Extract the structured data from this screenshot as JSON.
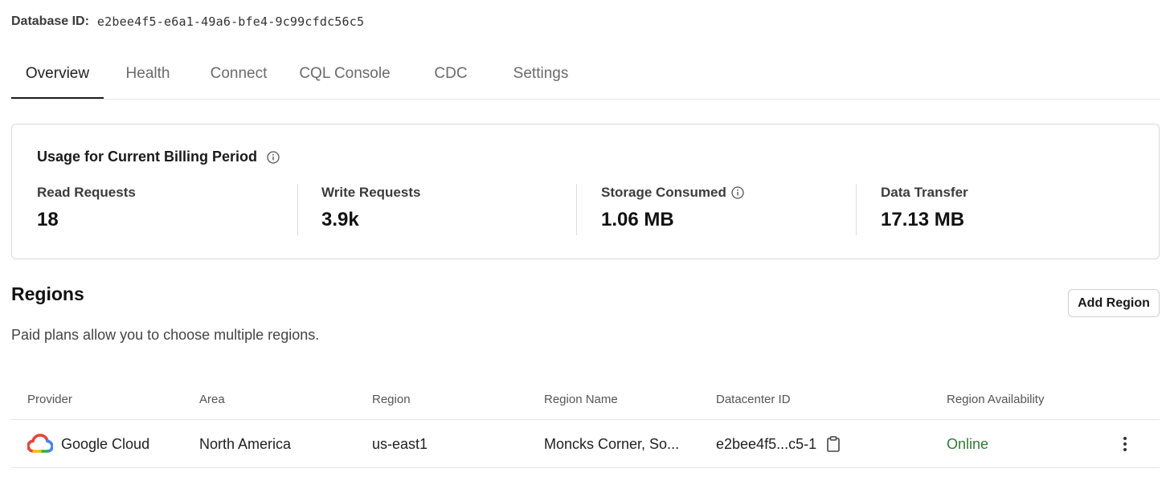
{
  "database": {
    "id_label": "Database ID:",
    "id_value": "e2bee4f5-e6a1-49a6-bfe4-9c99cfdc56c5"
  },
  "tabs": [
    {
      "label": "Overview",
      "active": true
    },
    {
      "label": "Health",
      "active": false
    },
    {
      "label": "Connect",
      "active": false
    },
    {
      "label": "CQL Console",
      "active": false
    },
    {
      "label": "CDC",
      "active": false
    },
    {
      "label": "Settings",
      "active": false
    }
  ],
  "usage": {
    "title": "Usage for Current Billing Period",
    "title_icon": "info-icon",
    "metrics": [
      {
        "label": "Read Requests",
        "value": "18",
        "has_info": false
      },
      {
        "label": "Write Requests",
        "value": "3.9k",
        "has_info": false
      },
      {
        "label": "Storage Consumed",
        "value": "1.06 MB",
        "has_info": true
      },
      {
        "label": "Data Transfer",
        "value": "17.13 MB",
        "has_info": false
      }
    ]
  },
  "regions": {
    "title": "Regions",
    "subtitle": "Paid plans allow you to choose multiple regions.",
    "add_button_label": "Add Region",
    "columns": [
      "Provider",
      "Area",
      "Region",
      "Region Name",
      "Datacenter ID",
      "Region Availability"
    ],
    "rows": [
      {
        "provider": "Google Cloud",
        "provider_icon": "google-cloud-icon",
        "area": "North America",
        "region": "us-east1",
        "region_name": "Moncks Corner, So...",
        "datacenter_id": "e2bee4f5...c5-1",
        "availability": "Online",
        "availability_color": "#2e7d32"
      }
    ]
  },
  "colors": {
    "text_primary": "#1a1a1a",
    "tab_inactive": "#6b6b6b",
    "border": "#d9d9d9",
    "online": "#2e7d32"
  }
}
